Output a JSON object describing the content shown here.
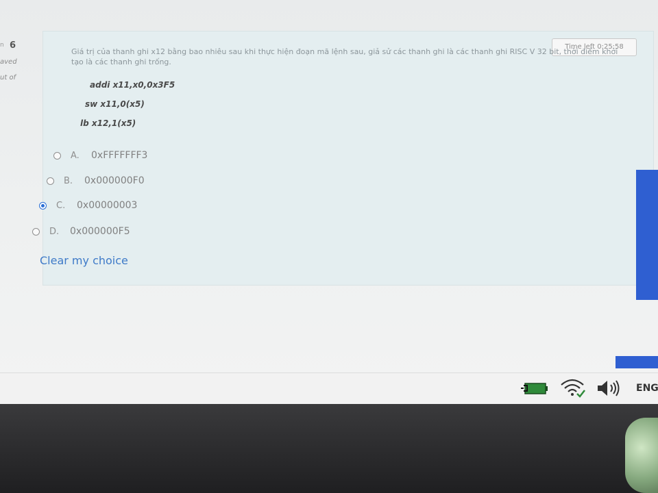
{
  "question_nav": {
    "prefix": "n",
    "number": "6",
    "state": "aved",
    "marks": "ut of"
  },
  "timer": {
    "text": "Time left 0:25:58"
  },
  "question": {
    "text": "Giá trị của thanh ghi x12 bằng bao nhiêu sau khi thực hiện đoạn mã lệnh sau, giả sử các thanh ghi là các thanh ghi RISC V 32 bit, thời điểm khởi tạo là các thanh ghi trống.",
    "code": [
      "addi x11,x0,0x3F5",
      "sw x11,0(x5)",
      "lb x12,1(x5)"
    ]
  },
  "options": [
    {
      "letter": "A.",
      "text": "0xFFFFFFF3",
      "selected": false
    },
    {
      "letter": "B.",
      "text": "0x000000F0",
      "selected": false
    },
    {
      "letter": "C.",
      "text": "0x00000003",
      "selected": true
    },
    {
      "letter": "D.",
      "text": "0x000000F5",
      "selected": false
    }
  ],
  "clear_choice": "Clear my choice",
  "taskbar": {
    "language": "ENG",
    "icons": [
      "battery-charging-icon",
      "wifi-icon",
      "speaker-icon"
    ]
  },
  "colors": {
    "accent": "#2a6fd6",
    "link": "#3e7ac8",
    "side_button": "#2f5fd1"
  }
}
